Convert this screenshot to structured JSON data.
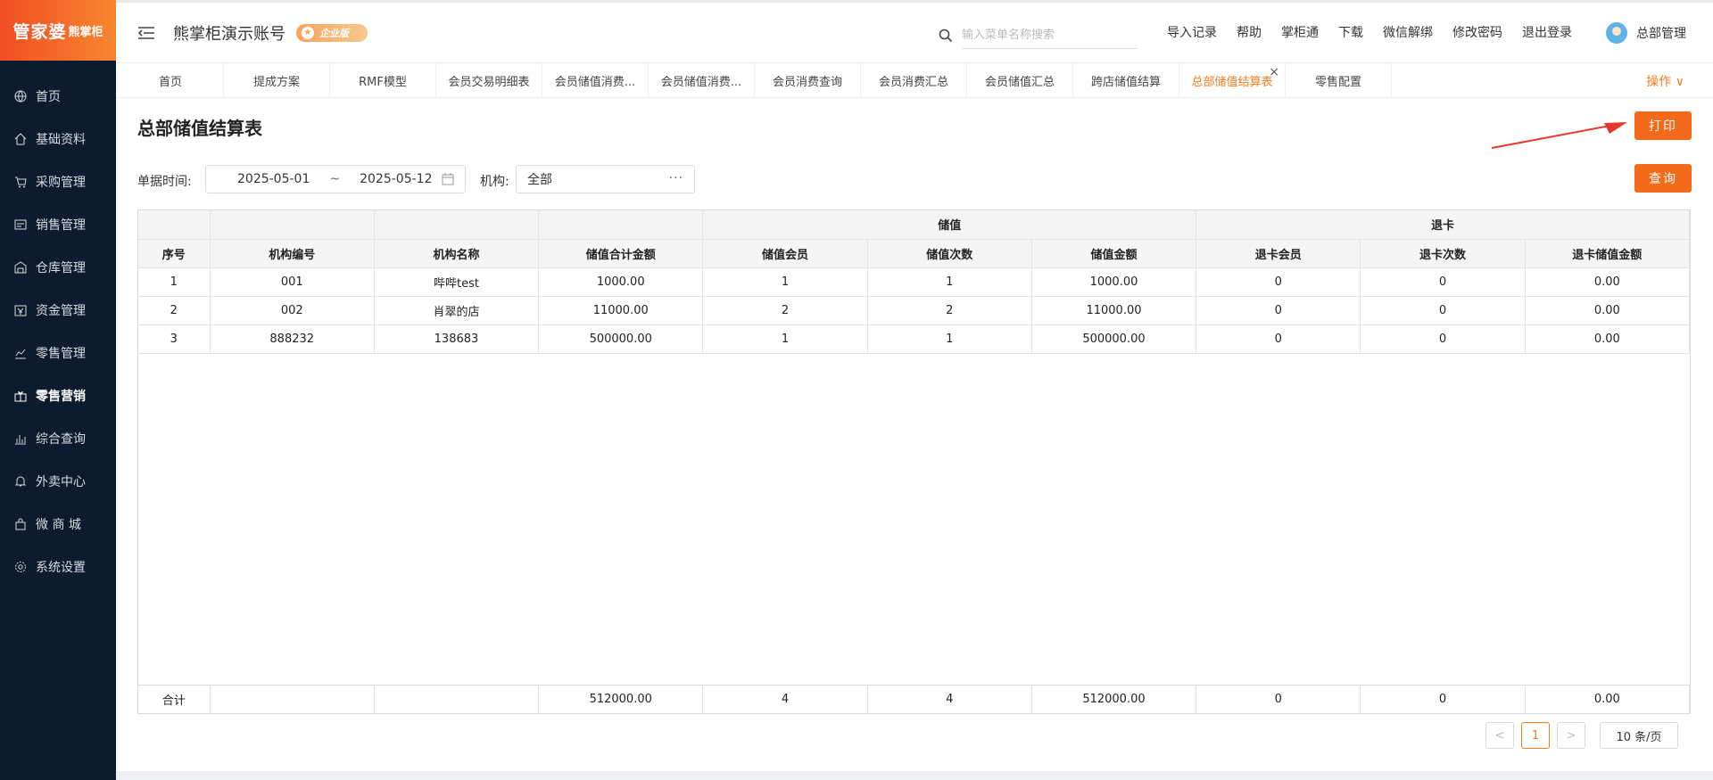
{
  "logo": {
    "main": "管家婆",
    "sub": "熊掌柜"
  },
  "sidebar": {
    "items": [
      {
        "label": "首页",
        "icon": "globe-icon"
      },
      {
        "label": "基础资料",
        "icon": "home-icon"
      },
      {
        "label": "采购管理",
        "icon": "cart-icon"
      },
      {
        "label": "销售管理",
        "icon": "sales-icon"
      },
      {
        "label": "仓库管理",
        "icon": "warehouse-icon"
      },
      {
        "label": "资金管理",
        "icon": "money-icon"
      },
      {
        "label": "零售管理",
        "icon": "chart-icon"
      },
      {
        "label": "零售营销",
        "icon": "gift-icon"
      },
      {
        "label": "综合查询",
        "icon": "bar-chart-icon"
      },
      {
        "label": "外卖中心",
        "icon": "bell-icon"
      },
      {
        "label": "微 商 城",
        "icon": "bag-icon"
      },
      {
        "label": "系统设置",
        "icon": "gear-icon"
      }
    ],
    "active_index": 7
  },
  "header": {
    "account": "熊掌柜演示账号",
    "badge": "企业版",
    "search_placeholder": "输入菜单名称搜索",
    "links": [
      "导入记录",
      "帮助",
      "掌柜通",
      "下载",
      "微信解绑",
      "修改密码",
      "退出登录"
    ],
    "user": "总部管理"
  },
  "tabs": {
    "items": [
      "首页",
      "提成方案",
      "RMF模型",
      "会员交易明细表",
      "会员储值消费...",
      "会员储值消费...",
      "会员消费查询",
      "会员消费汇总",
      "会员储值汇总",
      "跨店储值结算",
      "总部储值结算表",
      "零售配置"
    ],
    "active_index": 10,
    "ops": "操作 ∨"
  },
  "page": {
    "title": "总部储值结算表",
    "print_label": "打印",
    "query_label": "查询",
    "date_label": "单据时间:",
    "date_from": "2025-05-01",
    "date_sep": "~",
    "date_to": "2025-05-12",
    "org_label": "机构:",
    "org_value": "全部",
    "org_more": "···"
  },
  "table": {
    "group_headers": {
      "stored": "储值",
      "refund": "退卡"
    },
    "columns": [
      "序号",
      "机构编号",
      "机构名称",
      "储值合计金额",
      "储值会员",
      "储值次数",
      "储值金额",
      "退卡会员",
      "退卡次数",
      "退卡储值金额"
    ],
    "rows": [
      [
        "1",
        "001",
        "哔哔test",
        "1000.00",
        "1",
        "1",
        "1000.00",
        "0",
        "0",
        "0.00"
      ],
      [
        "2",
        "002",
        "肖翠的店",
        "11000.00",
        "2",
        "2",
        "11000.00",
        "0",
        "0",
        "0.00"
      ],
      [
        "3",
        "888232",
        "138683",
        "500000.00",
        "1",
        "1",
        "500000.00",
        "0",
        "0",
        "0.00"
      ]
    ],
    "totals": [
      "合计",
      "",
      "",
      "512000.00",
      "4",
      "4",
      "512000.00",
      "0",
      "0",
      "0.00"
    ]
  },
  "pager": {
    "prev": "<",
    "current": "1",
    "next": ">",
    "page_size": "10 条/页"
  },
  "colors": {
    "accent": "#f56a1a",
    "sidebar": "#0d1b2e"
  }
}
